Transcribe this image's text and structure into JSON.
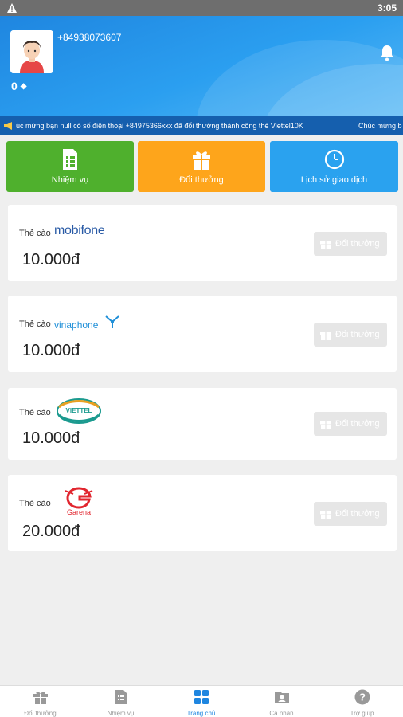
{
  "status_bar": {
    "time": "3:05"
  },
  "header": {
    "phone": "+84938073607",
    "points": "0"
  },
  "marquee": {
    "text1": "úc mừng bạn null có số điện thoại +84975366xxx đã đổi thưởng thành công thẻ Viettel10K",
    "text2": "Chúc mừng b"
  },
  "actions": [
    {
      "label": "Nhiệm vụ",
      "color": "#4fb02d"
    },
    {
      "label": "Đổi thưởng",
      "color": "#fea51b"
    },
    {
      "label": "Lịch sử giao dịch",
      "color": "#2aa2ef"
    }
  ],
  "cards": [
    {
      "label": "Thẻ cào",
      "brand": "mobifone",
      "amount": "10.000đ",
      "button": "Đổi thưởng"
    },
    {
      "label": "Thẻ cào",
      "brand": "vinaphone",
      "amount": "10.000đ",
      "button": "Đổi thưởng"
    },
    {
      "label": "Thẻ cào",
      "brand": "VIETTEL",
      "amount": "10.000đ",
      "button": "Đổi thưởng"
    },
    {
      "label": "Thẻ cào",
      "brand": "Garena",
      "amount": "20.000đ",
      "button": "Đổi thưởng"
    }
  ],
  "nav": [
    {
      "label": "Đổi thưởng",
      "icon": "gift-icon"
    },
    {
      "label": "Nhiệm vụ",
      "icon": "task-icon"
    },
    {
      "label": "Trang chủ",
      "icon": "home-grid-icon",
      "active": true
    },
    {
      "label": "Cá nhân",
      "icon": "profile-icon"
    },
    {
      "label": "Trợ giúp",
      "icon": "help-icon"
    }
  ],
  "colors": {
    "accent": "#1f86e0",
    "nav_inactive": "#999999",
    "button_disabled": "#e6e6e6"
  }
}
